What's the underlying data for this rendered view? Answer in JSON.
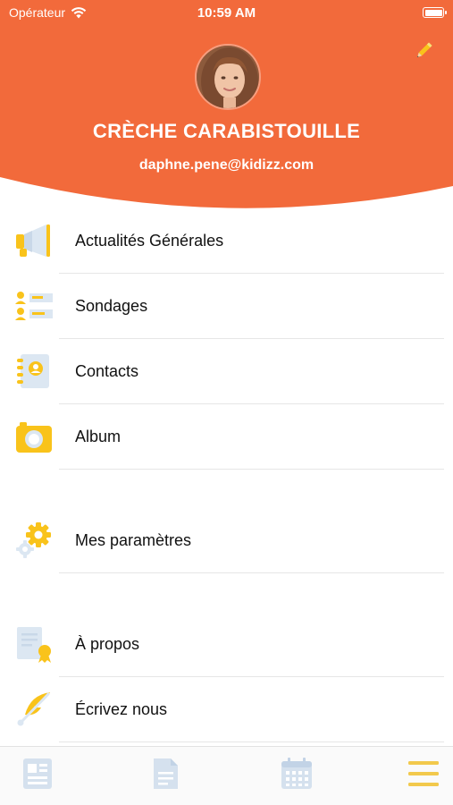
{
  "status_bar": {
    "carrier": "Opérateur",
    "time": "10:59 AM"
  },
  "profile": {
    "name": "CRÈCHE CARABISTOUILLE",
    "email": "daphne.pene@kidizz.com"
  },
  "menu": {
    "items": [
      {
        "label": "Actualités Générales",
        "icon": "megaphone-icon"
      },
      {
        "label": "Sondages",
        "icon": "poll-list-icon"
      },
      {
        "label": "Contacts",
        "icon": "address-book-icon"
      },
      {
        "label": "Album",
        "icon": "camera-icon"
      },
      {
        "label": "Mes paramètres",
        "icon": "gear-icon"
      },
      {
        "label": "À propos",
        "icon": "certificate-icon"
      },
      {
        "label": "Écrivez nous",
        "icon": "feather-pen-icon"
      }
    ]
  },
  "tabbar": {
    "tabs": [
      {
        "icon": "newsfeed-icon",
        "active": false
      },
      {
        "icon": "document-icon",
        "active": false
      },
      {
        "icon": "calendar-icon",
        "active": false
      },
      {
        "icon": "hamburger-menu-icon",
        "active": true
      }
    ]
  },
  "colors": {
    "brand_orange": "#F26A3B",
    "icon_yellow": "#F9C31B",
    "icon_pale_blue": "#DCE7F2",
    "tab_inactive": "#D5E1EE",
    "tab_active": "#F2C94C"
  }
}
